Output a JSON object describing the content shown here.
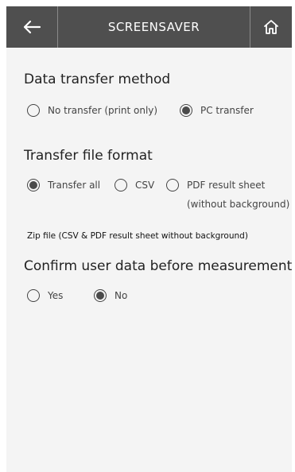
{
  "header": {
    "title": "SCREENSAVER",
    "colors": {
      "bar": "#4f4f4f",
      "text": "#ffffff"
    },
    "back_icon": "arrow-left-icon",
    "home_icon": "home-icon"
  },
  "data_transfer": {
    "title": "Data transfer method",
    "options": [
      {
        "label": "No transfer (print only)",
        "selected": false
      },
      {
        "label": "PC transfer",
        "selected": true
      }
    ]
  },
  "file_format": {
    "title": "Transfer file format",
    "options": [
      {
        "label": "Transfer all",
        "selected": true
      },
      {
        "label": "CSV",
        "selected": false
      },
      {
        "label": "PDF result sheet",
        "sublabel": "(without background)",
        "selected": false
      }
    ],
    "note": "Zip file (CSV & PDF result sheet without background)"
  },
  "confirm_user": {
    "title": "Confirm user data before measurement",
    "options": [
      {
        "label": "Yes",
        "selected": false
      },
      {
        "label": "No",
        "selected": true
      }
    ]
  }
}
